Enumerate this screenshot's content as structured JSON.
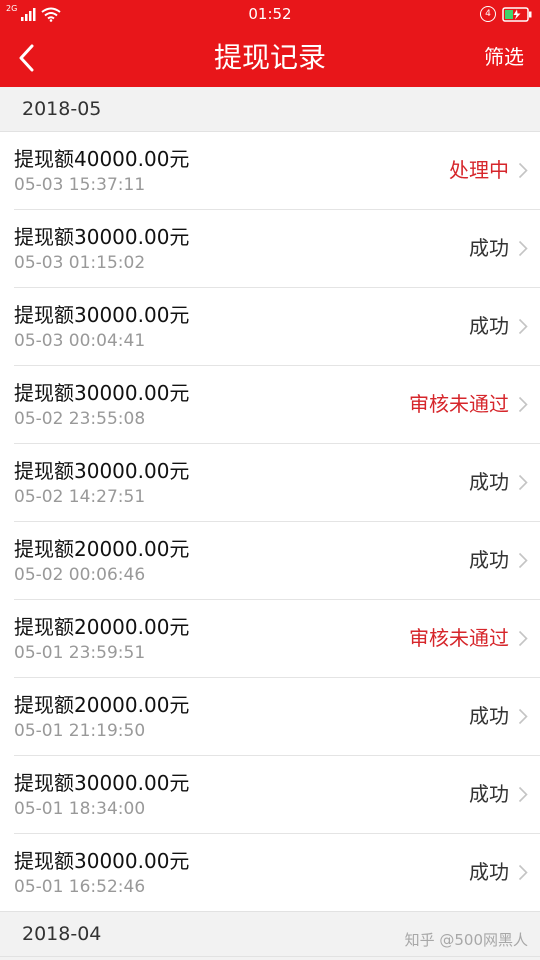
{
  "status_bar": {
    "network_label": "2G",
    "time": "01:52",
    "alarm_label": "4"
  },
  "nav": {
    "title": "提现记录",
    "filter_label": "筛选"
  },
  "sections": [
    {
      "month": "2018-05",
      "records": [
        {
          "amount": "提现额40000.00元",
          "time": "05-03 15:37:11",
          "status": "处理中",
          "status_type": "processing"
        },
        {
          "amount": "提现额30000.00元",
          "time": "05-03 01:15:02",
          "status": "成功",
          "status_type": "success"
        },
        {
          "amount": "提现额30000.00元",
          "time": "05-03 00:04:41",
          "status": "成功",
          "status_type": "success"
        },
        {
          "amount": "提现额30000.00元",
          "time": "05-02 23:55:08",
          "status": "审核未通过",
          "status_type": "rejected"
        },
        {
          "amount": "提现额30000.00元",
          "time": "05-02 14:27:51",
          "status": "成功",
          "status_type": "success"
        },
        {
          "amount": "提现额20000.00元",
          "time": "05-02 00:06:46",
          "status": "成功",
          "status_type": "success"
        },
        {
          "amount": "提现额20000.00元",
          "time": "05-01 23:59:51",
          "status": "审核未通过",
          "status_type": "rejected"
        },
        {
          "amount": "提现额20000.00元",
          "time": "05-01 21:19:50",
          "status": "成功",
          "status_type": "success"
        },
        {
          "amount": "提现额30000.00元",
          "time": "05-01 18:34:00",
          "status": "成功",
          "status_type": "success"
        },
        {
          "amount": "提现额30000.00元",
          "time": "05-01 16:52:46",
          "status": "成功",
          "status_type": "success"
        }
      ]
    },
    {
      "month": "2018-04",
      "records": []
    }
  ],
  "watermark": "知乎 @500网黑人",
  "colors": {
    "brand_red": "#e8161a",
    "status_red": "#d6262b",
    "background": "#f2f2f2"
  }
}
